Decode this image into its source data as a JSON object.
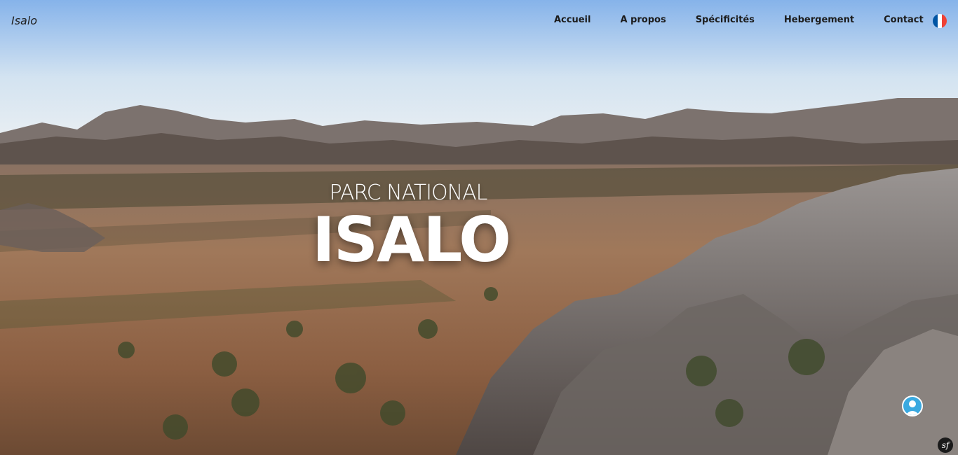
{
  "navbar": {
    "brand": "Isalo",
    "links": [
      {
        "label": "Accueil"
      },
      {
        "label": "A propos"
      },
      {
        "label": "Spécificités"
      },
      {
        "label": "Hebergement"
      },
      {
        "label": "Contact"
      }
    ],
    "language_icon": "france-flag-icon"
  },
  "hero": {
    "subtitle": "PARC NATIONAL",
    "title": "ISALO",
    "background_icon": "isalo-landscape-photo"
  },
  "widgets": {
    "chat_icon": "user-avatar-chat-icon",
    "debug_icon": "symfony-toolbar-icon",
    "debug_label": "sf"
  },
  "colors": {
    "nav_text": "#1c1c1c",
    "hero_text": "#ffffff",
    "chat_accent": "#3aa9e0",
    "flag_blue": "#0055a4",
    "flag_white": "#ffffff",
    "flag_red": "#ef4135"
  }
}
